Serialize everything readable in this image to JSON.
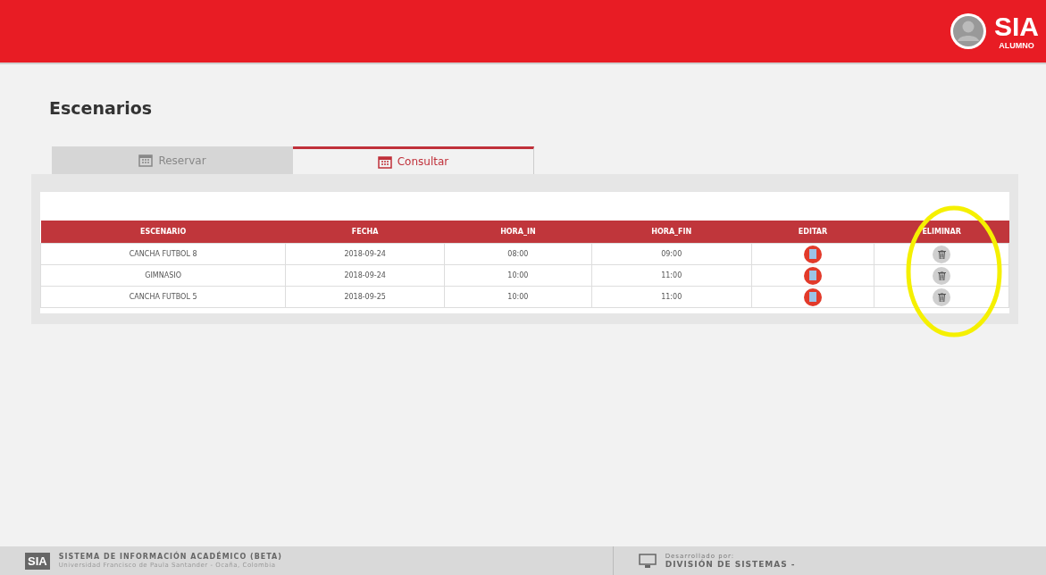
{
  "header": {
    "brand": "SIA",
    "brand_sub": "ALUMNO"
  },
  "page_title": "Escenarios",
  "tabs": [
    {
      "label": "Reservar",
      "selected": false
    },
    {
      "label": "Consultar",
      "selected": true
    }
  ],
  "table": {
    "columns": [
      "ESCENARIO",
      "FECHA",
      "HORA_IN",
      "HORA_FIN",
      "EDITAR",
      "ELIMINAR"
    ],
    "rows": [
      {
        "escenario": "CANCHA FUTBOL 8",
        "fecha": "2018-09-24",
        "hora_in": "08:00",
        "hora_fin": "09:00"
      },
      {
        "escenario": "GIMNASIO",
        "fecha": "2018-09-24",
        "hora_in": "10:00",
        "hora_fin": "11:00"
      },
      {
        "escenario": "CANCHA FUTBOL 5",
        "fecha": "2018-09-25",
        "hora_in": "10:00",
        "hora_fin": "11:00"
      }
    ]
  },
  "footer": {
    "logo": "SIA",
    "system_name": "SISTEMA DE INFORMACIÓN ACADÉMICO (BETA)",
    "university": "Universidad Francisco de Paula Santander - Ocaña, Colombia",
    "developed_label": "Desarrollado por:",
    "developer": "DIVISIÓN DE SISTEMAS -"
  }
}
